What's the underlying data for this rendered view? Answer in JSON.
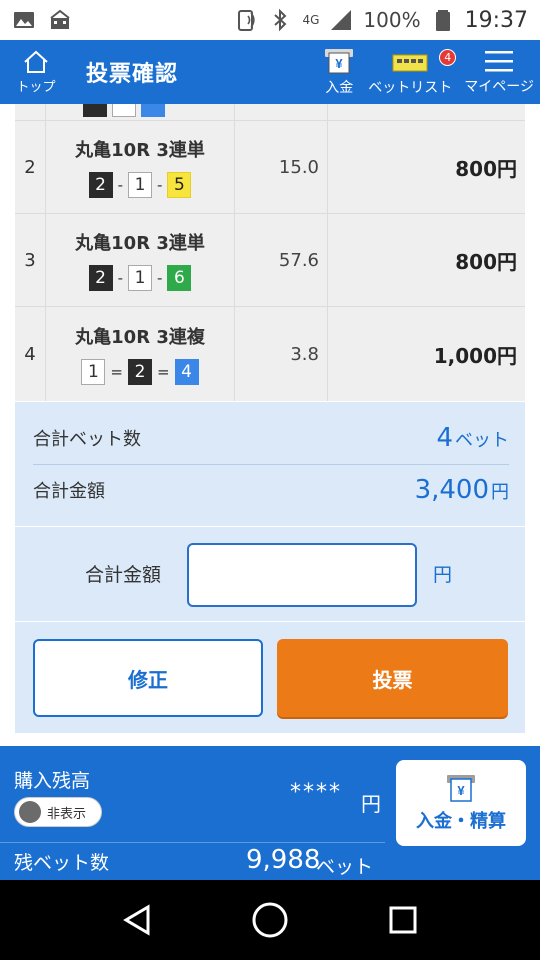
{
  "status_bar": {
    "battery": "100%",
    "time": "19:37",
    "network": "4G"
  },
  "header": {
    "home_label": "トップ",
    "title": "投票確認",
    "deposit_label": "入金",
    "betlist_label": "ベットリスト",
    "betlist_badge": "4",
    "mypage_label": "マイページ"
  },
  "bets": [
    {
      "no": "2",
      "title": "丸亀10R 3連単",
      "odds": "15.0",
      "amount": "800円",
      "combo": [
        {
          "num": "2",
          "color": "black"
        },
        {
          "sep": "-"
        },
        {
          "num": "1",
          "color": "white"
        },
        {
          "sep": "-"
        },
        {
          "num": "5",
          "color": "yellow"
        }
      ]
    },
    {
      "no": "3",
      "title": "丸亀10R 3連単",
      "odds": "57.6",
      "amount": "800円",
      "combo": [
        {
          "num": "2",
          "color": "black"
        },
        {
          "sep": "-"
        },
        {
          "num": "1",
          "color": "white"
        },
        {
          "sep": "-"
        },
        {
          "num": "6",
          "color": "green"
        }
      ]
    },
    {
      "no": "4",
      "title": "丸亀10R 3連複",
      "odds": "3.8",
      "amount": "1,000円",
      "combo": [
        {
          "num": "1",
          "color": "white"
        },
        {
          "sep": "="
        },
        {
          "num": "2",
          "color": "black"
        },
        {
          "sep": "="
        },
        {
          "num": "4",
          "color": "blue"
        }
      ]
    }
  ],
  "summary": {
    "bet_count_label": "合計ベット数",
    "bet_count_value": "4",
    "bet_count_unit": "ベット",
    "total_amount_label": "合計金額",
    "total_amount_value": "3,400",
    "total_amount_unit": "円",
    "input_label": "合計金額",
    "input_value": "",
    "input_unit": "円",
    "fix_button": "修正",
    "vote_button": "投票"
  },
  "balance": {
    "purchase_label": "購入残高",
    "toggle_label": "非表示",
    "hidden_value": "****",
    "unit": "円",
    "remaining_label": "残ベット数",
    "remaining_value": "9,988",
    "remaining_unit": "ベット",
    "deposit_button": "入金・精算"
  },
  "colors": {
    "primary": "#1a6fd1",
    "vote": "#ec7a17",
    "summary_bg": "#dbe9f8"
  }
}
